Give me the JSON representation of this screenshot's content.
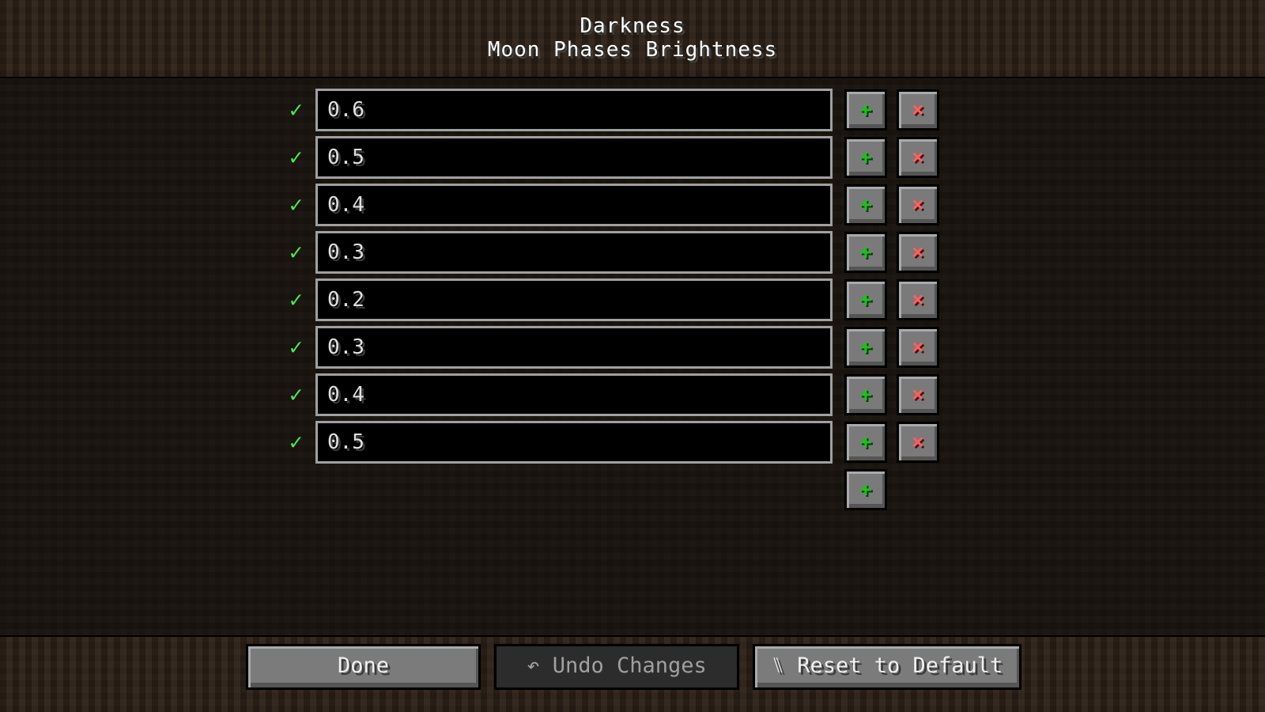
{
  "header": {
    "title": "Darkness",
    "subtitle": "Moon Phases Brightness"
  },
  "entries": [
    {
      "value": "0.6",
      "valid": true
    },
    {
      "value": "0.5",
      "valid": true
    },
    {
      "value": "0.4",
      "valid": true
    },
    {
      "value": "0.3",
      "valid": true
    },
    {
      "value": "0.2",
      "valid": true
    },
    {
      "value": "0.3",
      "valid": true
    },
    {
      "value": "0.4",
      "valid": true
    },
    {
      "value": "0.5",
      "valid": true
    }
  ],
  "icons": {
    "valid": "check-icon",
    "add": "plus-icon",
    "remove": "x-icon",
    "undo": "undo-arrow-icon",
    "reset": "reset-icon"
  },
  "glyphs": {
    "check": "✓",
    "plus": "+",
    "remove": "×",
    "undo": "↶",
    "reset": "⑊"
  },
  "colors": {
    "check": "#4ee84e",
    "add": "#1fbf1f",
    "remove": "#ff6060"
  },
  "footer": {
    "done": "Done",
    "undo": "Undo Changes",
    "reset": "Reset to Default"
  }
}
